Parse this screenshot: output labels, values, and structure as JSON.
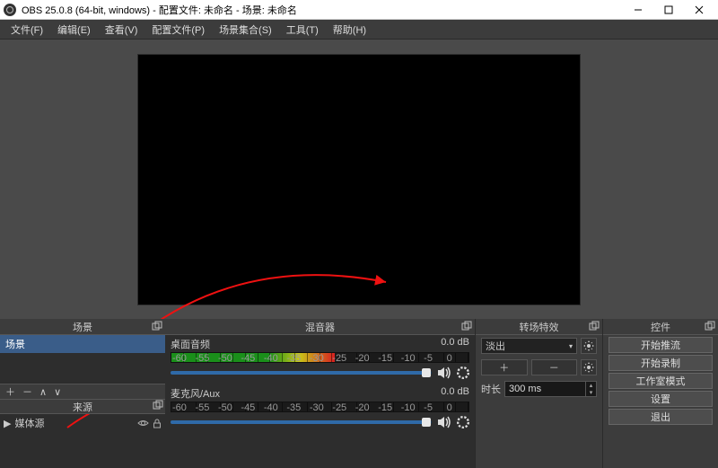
{
  "window": {
    "title": "OBS 25.0.8 (64-bit, windows) - 配置文件: 未命名 - 场景: 未命名"
  },
  "menu": {
    "file": "文件(F)",
    "edit": "编辑(E)",
    "view": "查看(V)",
    "profile": "配置文件(P)",
    "scene_collection": "场景集合(S)",
    "tools": "工具(T)",
    "help": "帮助(H)"
  },
  "panels": {
    "scenes": "场景",
    "sources": "来源",
    "mixer": "混音器",
    "transitions": "转场特效",
    "controls": "控件"
  },
  "scenes": {
    "items": [
      "场景"
    ]
  },
  "sources": {
    "items": [
      {
        "label": "媒体源"
      }
    ]
  },
  "toolbar_glyphs": {
    "add": "＋",
    "remove": "－",
    "up": "∧",
    "down": "∨"
  },
  "mixer": {
    "channels": [
      {
        "name": "桌面音频",
        "db": "0.0 dB",
        "level_pct": 55,
        "vol_pct": 98
      },
      {
        "name": "麦克风/Aux",
        "db": "0.0 dB",
        "level_pct": 0,
        "vol_pct": 98
      }
    ],
    "tick_labels": [
      "-60",
      "-55",
      "-50",
      "-45",
      "-40",
      "-35",
      "-30",
      "-25",
      "-20",
      "-15",
      "-10",
      "-5",
      "0"
    ]
  },
  "transitions": {
    "current": "淡出",
    "duration_label": "时长",
    "duration_value": "300 ms"
  },
  "controls": {
    "buttons": [
      "开始推流",
      "开始录制",
      "工作室模式",
      "设置",
      "退出"
    ]
  }
}
